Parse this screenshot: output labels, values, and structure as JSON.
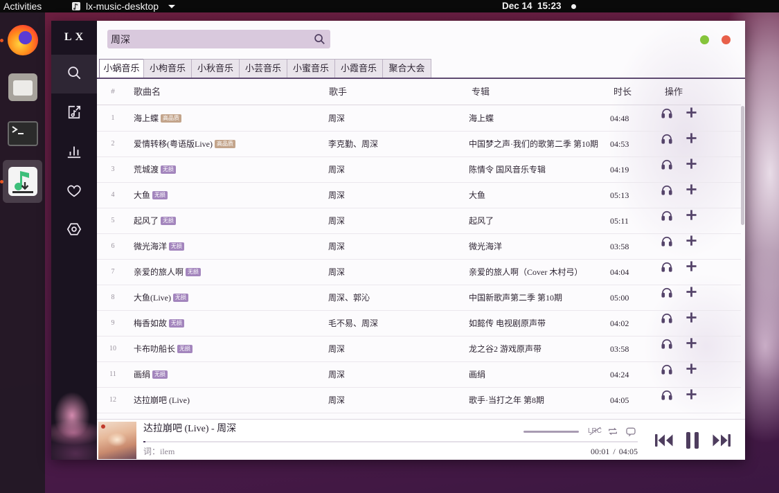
{
  "topbar": {
    "activities": "Activities",
    "app_name": "lx-music-desktop",
    "clock": "Dec 14  15:23"
  },
  "dock": {
    "items": [
      "firefox-icon",
      "files-icon",
      "terminal-icon",
      "lx-music-icon"
    ],
    "active": "lx-music-icon",
    "running_indicator_color": "#e95420"
  },
  "app": {
    "logo": "L X",
    "sidebar": {
      "items": [
        "search-icon",
        "song-list-icon",
        "leaderboard-icon",
        "heart-icon",
        "settings-icon"
      ],
      "active": "search-icon"
    },
    "search": {
      "value": "周深"
    },
    "window_controls": {
      "minimize_color": "#85c43b",
      "close_color": "#e8604a"
    },
    "tabs": [
      {
        "label": "小蜗音乐",
        "active": true
      },
      {
        "label": "小枸音乐",
        "active": false
      },
      {
        "label": "小秋音乐",
        "active": false
      },
      {
        "label": "小芸音乐",
        "active": false
      },
      {
        "label": "小蜜音乐",
        "active": false
      },
      {
        "label": "小霞音乐",
        "active": false
      },
      {
        "label": "聚合大会",
        "active": false
      }
    ],
    "table": {
      "columns": {
        "index": "#",
        "name": "歌曲名",
        "singer": "歌手",
        "album": "专辑",
        "duration": "时长",
        "actions": "操作"
      },
      "quality_colors": {
        "高品质": "#c3a48b",
        "无损": "#a385bd"
      },
      "rows": [
        {
          "index": "1",
          "name": "海上蝶",
          "quality": "高品质",
          "singer": "周深",
          "album": "海上蝶",
          "duration": "04:48"
        },
        {
          "index": "2",
          "name": "爱情转移(粤语版Live)",
          "quality": "高品质",
          "singer": "李克勤、周深",
          "album": "中国梦之声·我们的歌第二季 第10期",
          "duration": "04:53"
        },
        {
          "index": "3",
          "name": "荒城渡",
          "quality": "无损",
          "singer": "周深",
          "album": "陈情令 国风音乐专辑",
          "duration": "04:19"
        },
        {
          "index": "4",
          "name": "大鱼",
          "quality": "无损",
          "singer": "周深",
          "album": "大鱼",
          "duration": "05:13"
        },
        {
          "index": "5",
          "name": "起风了",
          "quality": "无损",
          "singer": "周深",
          "album": "起风了",
          "duration": "05:11"
        },
        {
          "index": "6",
          "name": "微光海洋",
          "quality": "无损",
          "singer": "周深",
          "album": "微光海洋",
          "duration": "03:58"
        },
        {
          "index": "7",
          "name": "亲爱的旅人啊",
          "quality": "无损",
          "singer": "周深",
          "album": "亲爱的旅人啊（Cover 木村弓）",
          "duration": "04:04"
        },
        {
          "index": "8",
          "name": "大鱼(Live)",
          "quality": "无损",
          "singer": "周深、郭沁",
          "album": "中国新歌声第二季 第10期",
          "duration": "05:00"
        },
        {
          "index": "9",
          "name": "梅香如故",
          "quality": "无损",
          "singer": "毛不易、周深",
          "album": "如懿传 电视剧原声带",
          "duration": "04:02"
        },
        {
          "index": "10",
          "name": "卡布叻船长",
          "quality": "无损",
          "singer": "周深",
          "album": "龙之谷2 游戏原声带",
          "duration": "03:58"
        },
        {
          "index": "11",
          "name": "画绢",
          "quality": "无损",
          "singer": "周深",
          "album": "画绢",
          "duration": "04:24"
        },
        {
          "index": "12",
          "name": "达拉崩吧 (Live)",
          "quality": "",
          "singer": "周深",
          "album": "歌手·当打之年 第8期",
          "duration": "04:05"
        }
      ]
    },
    "player": {
      "title": "达拉崩吧 (Live) - 周深",
      "lyric": "词：ilem",
      "current_time": "00:01",
      "time_separator": "/",
      "total_time": "04:05",
      "progress": 0.004,
      "lrc_label": "LRC"
    }
  },
  "colors": {
    "accent": "#4e3d5f",
    "sidebar_bg": "#1a1320",
    "search_bg": "#d9c9dd",
    "tab_underline": "#5e4a70"
  }
}
